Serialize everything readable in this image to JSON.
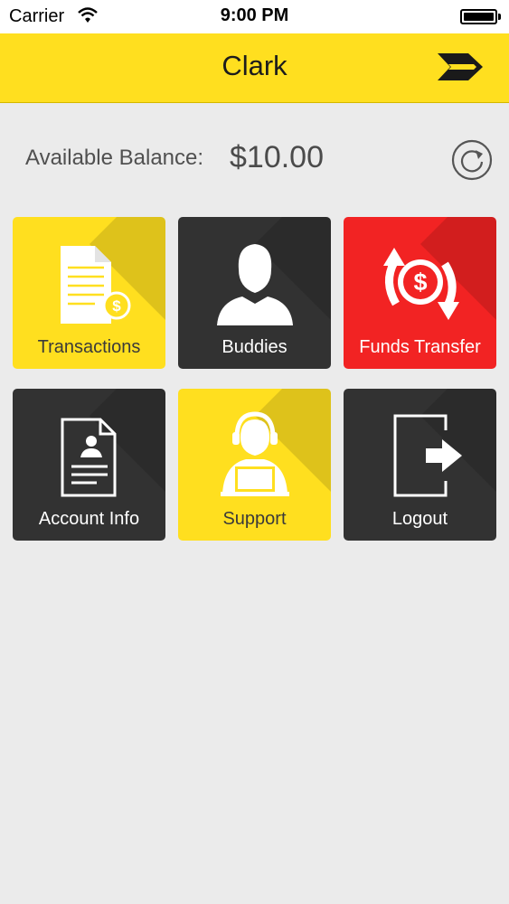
{
  "status_bar": {
    "carrier": "Carrier",
    "time": "9:00 PM"
  },
  "nav": {
    "title": "Clark",
    "menu_icon": "chevron-arrow-icon"
  },
  "balance": {
    "label": "Available Balance:",
    "value": "$10.00",
    "refresh_icon": "refresh-icon"
  },
  "tiles": [
    {
      "label": "Transactions",
      "icon": "document-dollar-icon",
      "color": "#ffdf1f"
    },
    {
      "label": "Buddies",
      "icon": "person-icon",
      "color": "#323232"
    },
    {
      "label": "Funds Transfer",
      "icon": "money-transfer-icon",
      "color": "#f22323"
    },
    {
      "label": "Account Info",
      "icon": "id-card-icon",
      "color": "#323232"
    },
    {
      "label": "Support",
      "icon": "support-agent-icon",
      "color": "#ffdf1f"
    },
    {
      "label": "Logout",
      "icon": "logout-icon",
      "color": "#323232"
    }
  ],
  "colors": {
    "accent": "#ffdf1f",
    "dark_tile": "#323232",
    "red_tile": "#f22323",
    "background": "#ebebeb"
  }
}
